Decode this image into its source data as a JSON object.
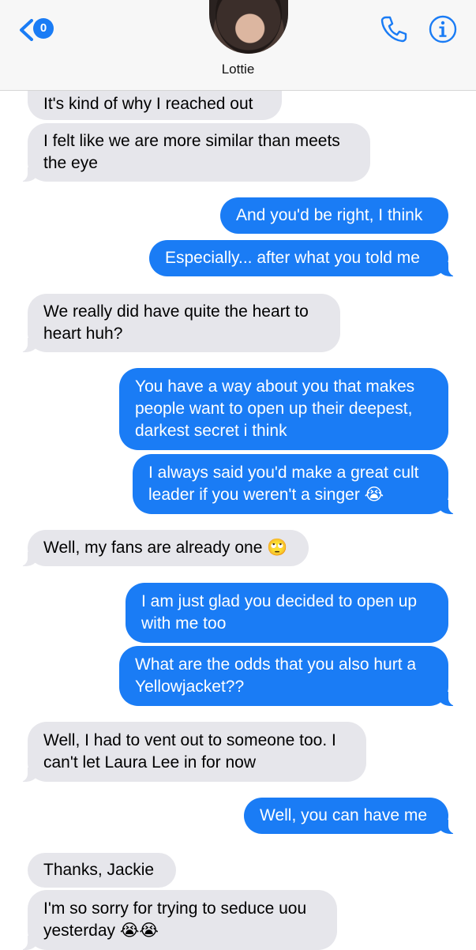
{
  "header": {
    "back_badge_count": "0",
    "contact_name": "Lottie",
    "accent_color": "#1a7cf5"
  },
  "icons": {
    "back": "chevron-left-icon",
    "call": "phone-icon",
    "details": "info-icon"
  },
  "messages": [
    {
      "side": "in",
      "lines": [
        "It's kind of why I reached out"
      ]
    },
    {
      "side": "in",
      "lines": [
        "I felt like we are more similar than meets",
        "the eye"
      ]
    },
    {
      "side": "out",
      "lines": [
        "And you'd be right, I think"
      ]
    },
    {
      "side": "out",
      "lines": [
        "Especially... after what you told me"
      ]
    },
    {
      "side": "in",
      "lines": [
        "We really did have quite the heart to",
        "heart huh?"
      ]
    },
    {
      "side": "out",
      "lines": [
        "You have a way about you that makes",
        "people want to open up their deepest,",
        "darkest secret i think"
      ]
    },
    {
      "side": "out",
      "lines": [
        "I always said you'd make a great cult",
        "leader if you weren't a singer 😭"
      ]
    },
    {
      "side": "in",
      "lines": [
        "Well, my fans are already one 🙄"
      ]
    },
    {
      "side": "out",
      "lines": [
        "I am just glad you decided to open up",
        "with me too"
      ]
    },
    {
      "side": "out",
      "lines": [
        "What are the odds that you also hurt a",
        "Yellowjacket??"
      ]
    },
    {
      "side": "in",
      "lines": [
        "Well, I had to vent out to someone too. I",
        "can't let Laura Lee in for now"
      ]
    },
    {
      "side": "out",
      "lines": [
        "Well, you can have me"
      ]
    },
    {
      "side": "in",
      "lines": [
        "Thanks, Jackie"
      ]
    },
    {
      "side": "in",
      "lines": [
        "I'm so sorry for trying to seduce uou",
        "yesterday 😭😭"
      ]
    }
  ]
}
